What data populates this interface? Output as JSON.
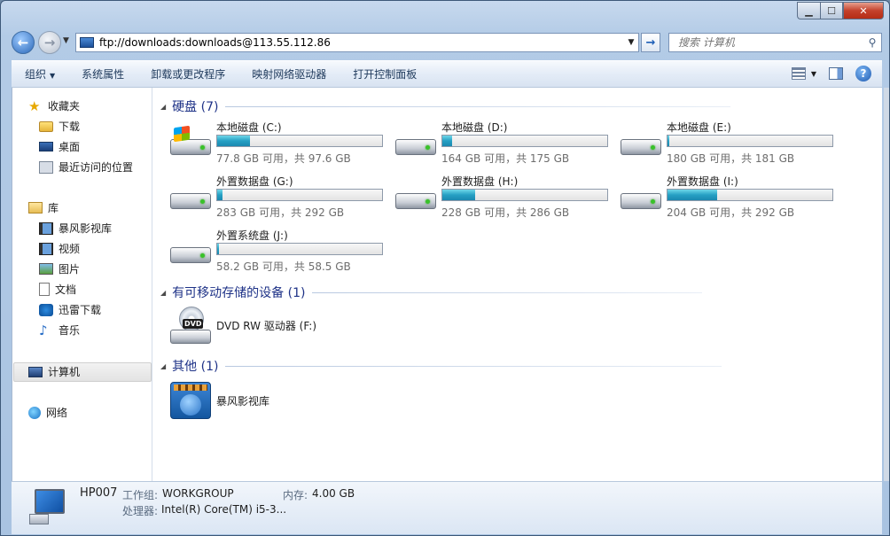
{
  "window": {
    "controls": {
      "minimize": "▁",
      "maximize": "☐",
      "close": "✕"
    }
  },
  "nav": {
    "address": "ftp://downloads:downloads@113.55.112.86",
    "search_placeholder": "搜索 计算机"
  },
  "toolbar": {
    "organize": "组织",
    "items": [
      "系统属性",
      "卸载或更改程序",
      "映射网络驱动器",
      "打开控制面板"
    ]
  },
  "sidebar": {
    "favorites": {
      "label": "收藏夹",
      "items": [
        "下载",
        "桌面",
        "最近访问的位置"
      ]
    },
    "libraries": {
      "label": "库",
      "items": [
        "暴风影视库",
        "视频",
        "图片",
        "文档",
        "迅雷下载",
        "音乐"
      ]
    },
    "computer": "计算机",
    "network": "网络"
  },
  "groups": {
    "hdd": "硬盘 (7)",
    "removable": "有可移动存储的设备 (1)",
    "other": "其他 (1)"
  },
  "drives": [
    {
      "name": "本地磁盘 (C:)",
      "size": "77.8 GB 可用，共 97.6 GB",
      "used_fraction": 0.2,
      "system": true
    },
    {
      "name": "本地磁盘 (D:)",
      "size": "164 GB 可用，共 175 GB",
      "used_fraction": 0.06
    },
    {
      "name": "本地磁盘 (E:)",
      "size": "180 GB 可用，共 181 GB",
      "used_fraction": 0.005
    },
    {
      "name": "外置数据盘 (G:)",
      "size": "283 GB 可用，共 292 GB",
      "used_fraction": 0.03
    },
    {
      "name": "外置数据盘 (H:)",
      "size": "228 GB 可用，共 286 GB",
      "used_fraction": 0.2
    },
    {
      "name": "外置数据盘 (I:)",
      "size": "204 GB 可用，共 292 GB",
      "used_fraction": 0.3
    },
    {
      "name": "外置系统盘 (J:)",
      "size": "58.2 GB 可用，共 58.5 GB",
      "used_fraction": 0.005
    }
  ],
  "removable": [
    {
      "name": "DVD RW 驱动器 (F:)",
      "badge": "DVD"
    }
  ],
  "other": [
    {
      "name": "暴风影视库"
    }
  ],
  "details": {
    "computer_name": "HP007",
    "workgroup_label": "工作组:",
    "workgroup": "WORKGROUP",
    "memory_label": "内存:",
    "memory": "4.00 GB",
    "cpu_label": "处理器:",
    "cpu": "Intel(R) Core(TM) i5-3..."
  },
  "colors": {
    "accent": "#1e3287",
    "bar_fill": "#26a0c4"
  }
}
